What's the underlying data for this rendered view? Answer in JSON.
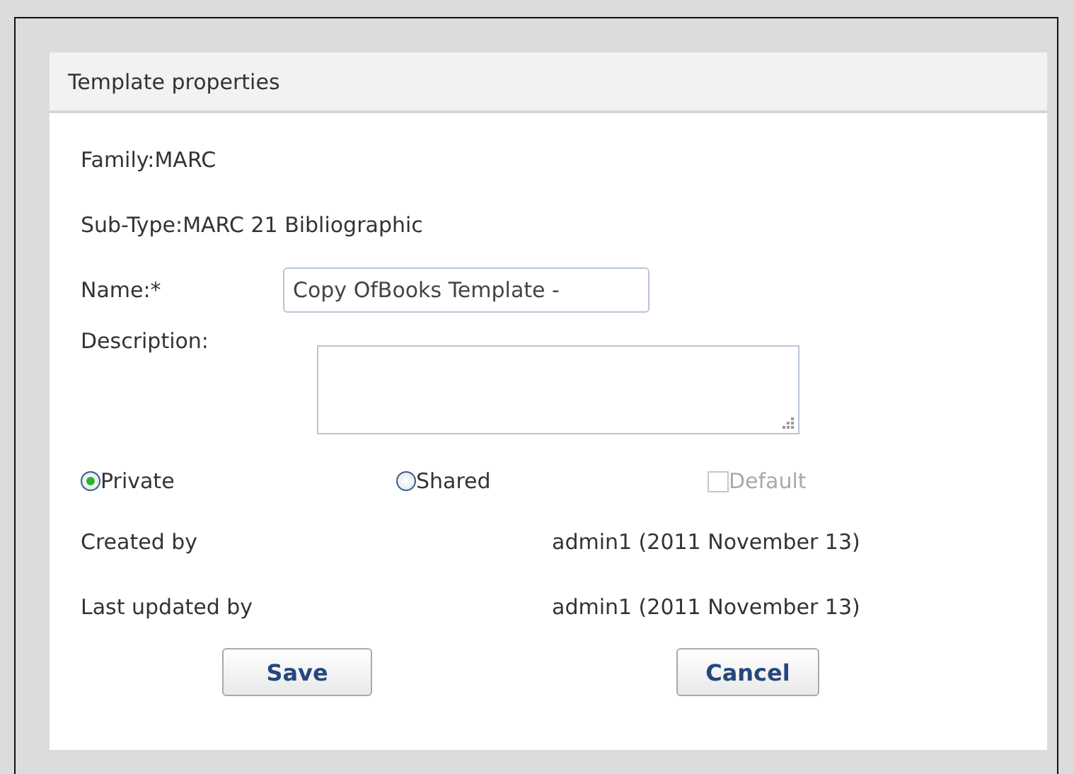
{
  "panel": {
    "title": "Template properties"
  },
  "family": {
    "label": "Family:",
    "value": "MARC"
  },
  "sub_type": {
    "label": "Sub-Type:",
    "value": "MARC 21 Bibliographic"
  },
  "name": {
    "label": "Name:*",
    "value": "Copy OfBooks Template -"
  },
  "description": {
    "label": "Description:"
  },
  "visibility": [
    {
      "label": "Private",
      "selected": true
    },
    {
      "label": "Shared",
      "selected": false
    }
  ],
  "default": {
    "label": "Default",
    "checked": false,
    "disabled": true
  },
  "info": [
    {
      "label": "Created by",
      "value": "admin1 (2011 November 13)"
    },
    {
      "label": "Last updated by",
      "value": "admin1 (2011 November 13)"
    }
  ],
  "buttons": [
    "Save",
    "Cancel"
  ]
}
